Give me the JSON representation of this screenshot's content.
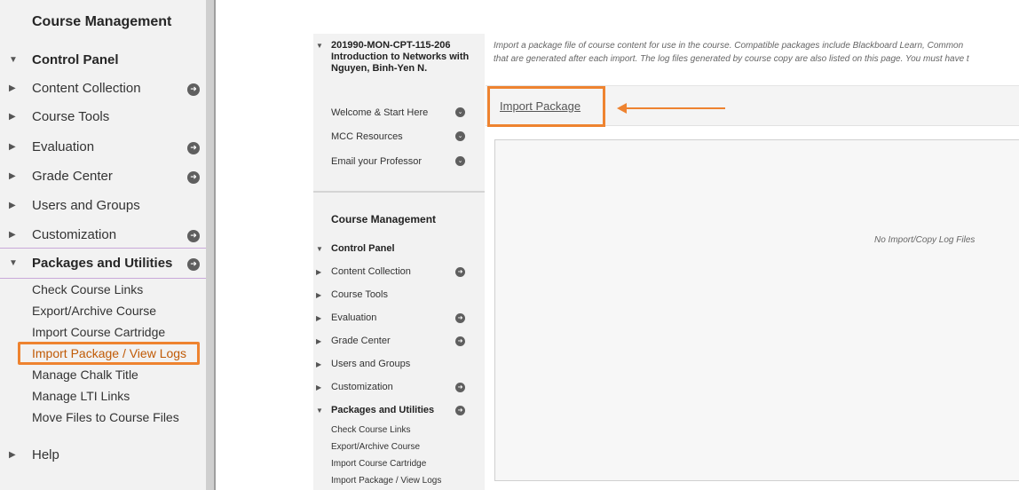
{
  "left_panel": {
    "title": "Course Management",
    "control_panel": "Control Panel",
    "items": [
      {
        "label": "Content Collection"
      },
      {
        "label": "Course Tools"
      },
      {
        "label": "Evaluation"
      },
      {
        "label": "Grade Center"
      },
      {
        "label": "Users and Groups"
      },
      {
        "label": "Customization"
      }
    ],
    "packages": "Packages and Utilities",
    "sub_items": [
      {
        "label": "Check Course Links"
      },
      {
        "label": "Export/Archive Course"
      },
      {
        "label": "Import Course Cartridge"
      },
      {
        "label": "Import Package / View Logs"
      },
      {
        "label": "Manage Chalk Title"
      },
      {
        "label": "Manage LTI Links"
      },
      {
        "label": "Move Files to Course Files"
      }
    ],
    "help": "Help",
    "highlight_color": "#ee8330"
  },
  "inner": {
    "course_title": "201990-MON-CPT-115-206 Introduction to Networks with Nguyen, Binh-Yen N.",
    "menu": [
      {
        "label": "Welcome & Start Here"
      },
      {
        "label": "MCC Resources"
      },
      {
        "label": "Email your Professor"
      }
    ],
    "cm_title": "Course Management",
    "control_panel": "Control Panel",
    "items": [
      {
        "label": "Content Collection"
      },
      {
        "label": "Course Tools"
      },
      {
        "label": "Evaluation"
      },
      {
        "label": "Grade Center"
      },
      {
        "label": "Users and Groups"
      },
      {
        "label": "Customization"
      }
    ],
    "packages": "Packages and Utilities",
    "sub_items": [
      {
        "label": "Check Course Links"
      },
      {
        "label": "Export/Archive Course"
      },
      {
        "label": "Import Course Cartridge"
      },
      {
        "label": "Import Package / View Logs"
      }
    ],
    "description_line1": "Import a package file of course content for use in the course. Compatible packages include Blackboard Learn, Common",
    "description_line2": "that are generated after each import. The log files generated by course copy are also listed on this page. You must have t",
    "import_package": "Import Package",
    "no_logs": "No Import/Copy Log Files"
  }
}
